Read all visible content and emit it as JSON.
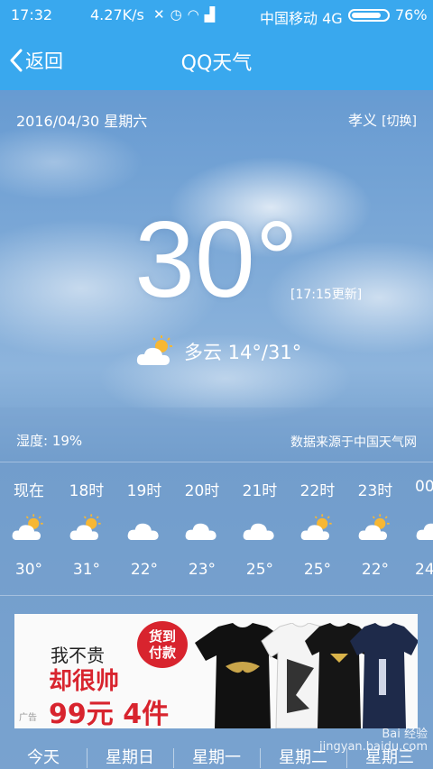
{
  "status_bar": {
    "time": "17:32",
    "speed": "4.27K/s",
    "carrier": "中国移动 4G",
    "battery": "76%"
  },
  "nav": {
    "back_label": "返回",
    "title": "QQ天气"
  },
  "weather": {
    "date": "2016/04/30 星期六",
    "city": "孝义",
    "switch_label": "[切换]",
    "temperature": "30°",
    "updated": "[17:15更新]",
    "condition": "多云 14°/31°",
    "humidity": "湿度: 19%",
    "source": "数据来源于中国天气网"
  },
  "hourly": [
    {
      "label": "现在",
      "icon": "partly-cloudy-icon",
      "temp": "30°"
    },
    {
      "label": "18时",
      "icon": "partly-cloudy-icon",
      "temp": "31°"
    },
    {
      "label": "19时",
      "icon": "cloudy-icon",
      "temp": "22°"
    },
    {
      "label": "20时",
      "icon": "cloudy-icon",
      "temp": "23°"
    },
    {
      "label": "21时",
      "icon": "cloudy-icon",
      "temp": "25°"
    },
    {
      "label": "22时",
      "icon": "partly-cloudy-icon",
      "temp": "25°"
    },
    {
      "label": "23时",
      "icon": "partly-cloudy-icon",
      "temp": "22°"
    },
    {
      "label": "00",
      "icon": "cloudy-icon",
      "temp": "24"
    }
  ],
  "ad": {
    "line1": "我不贵",
    "line2": "却很帅",
    "line3": "99元 4件",
    "badge_top": "货到",
    "badge_bottom": "付款",
    "tag": "广告"
  },
  "tabs": [
    "今天",
    "星期日",
    "星期一",
    "星期二",
    "星期三"
  ],
  "watermark": "Bai 经验\njingyan.baidu.com",
  "colors": {
    "bar": "#39a8ee",
    "ad_red": "#d8242e"
  }
}
